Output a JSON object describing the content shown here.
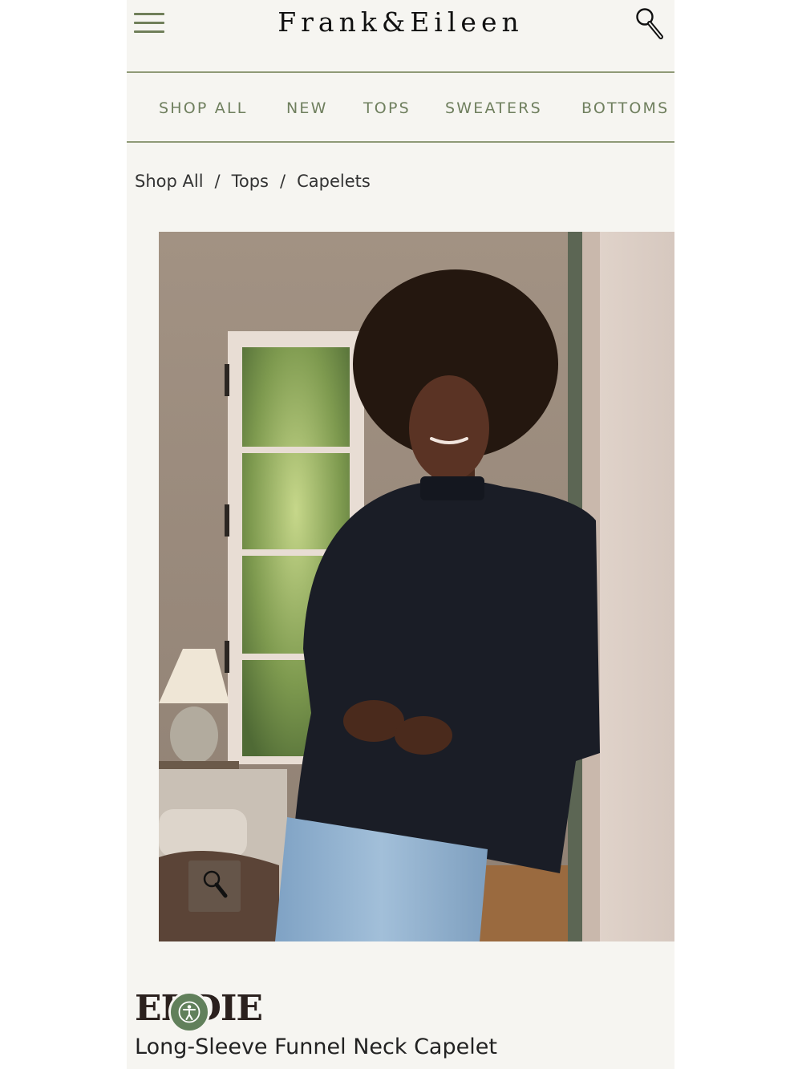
{
  "header": {
    "brand": "Frank&Eileen",
    "menu_icon": "hamburger-menu-icon",
    "search_icon": "search-icon"
  },
  "nav": {
    "items": [
      {
        "label": "SHOP ALL"
      },
      {
        "label": "NEW"
      },
      {
        "label": "TOPS"
      },
      {
        "label": "SWEATERS"
      },
      {
        "label": "BOTTOMS"
      }
    ]
  },
  "breadcrumb": {
    "items": [
      {
        "label": "Shop All"
      },
      {
        "label": "Tops"
      },
      {
        "label": "Capelets"
      }
    ],
    "separator": "/"
  },
  "product": {
    "collection": "EDDIE",
    "title": "Long-Sleeve Funnel Neck Capelet",
    "zoom_icon": "magnifier-icon",
    "accessibility_icon": "accessibility-icon"
  },
  "colors": {
    "accent": "#6f7f5e",
    "background": "#f6f5f1",
    "accessibility_badge": "#61805b"
  }
}
